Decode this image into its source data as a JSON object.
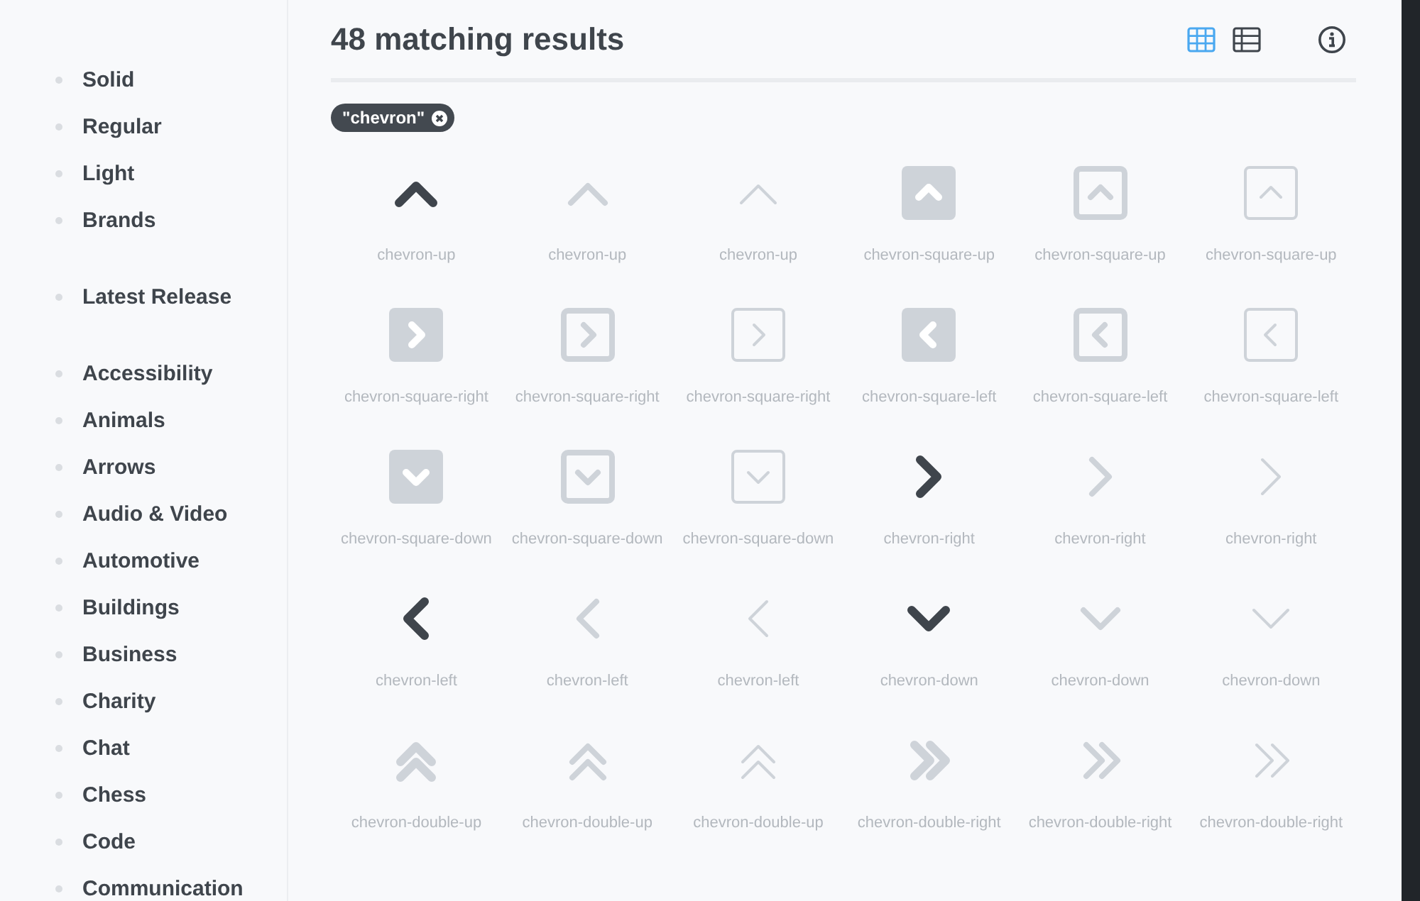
{
  "sidebar": {
    "groups": [
      {
        "items": [
          "Solid",
          "Regular",
          "Light",
          "Brands"
        ]
      },
      {
        "items": [
          "Latest Release"
        ]
      },
      {
        "items": [
          "Accessibility",
          "Animals",
          "Arrows",
          "Audio & Video",
          "Automotive",
          "Buildings",
          "Business",
          "Charity",
          "Chat",
          "Chess",
          "Code",
          "Communication"
        ]
      }
    ]
  },
  "header": {
    "title": "48 matching results",
    "views": [
      {
        "kind": "grid",
        "selected": true
      },
      {
        "kind": "list",
        "selected": false
      }
    ]
  },
  "filter_tag": {
    "label": "\"chevron\""
  },
  "icons": [
    {
      "kind": "upSolid",
      "available": true,
      "label": "chevron-up"
    },
    {
      "kind": "upRegular",
      "available": false,
      "label": "chevron-up"
    },
    {
      "kind": "upLight",
      "available": false,
      "label": "chevron-up"
    },
    {
      "kind": "squareUpSolid",
      "available": false,
      "label": "chevron-square-up"
    },
    {
      "kind": "squareUpRegular",
      "available": false,
      "label": "chevron-square-up"
    },
    {
      "kind": "squareUpLight",
      "available": false,
      "label": "chevron-square-up"
    },
    {
      "kind": "squareRightSolid",
      "available": false,
      "label": "chevron-square-right"
    },
    {
      "kind": "squareRightRegular",
      "available": false,
      "label": "chevron-square-right"
    },
    {
      "kind": "squareRightLight",
      "available": false,
      "label": "chevron-square-right"
    },
    {
      "kind": "squareLeftSolid",
      "available": false,
      "label": "chevron-square-left"
    },
    {
      "kind": "squareLeftRegular",
      "available": false,
      "label": "chevron-square-left"
    },
    {
      "kind": "squareLeftLight",
      "available": false,
      "label": "chevron-square-left"
    },
    {
      "kind": "squareDownSolid",
      "available": false,
      "label": "chevron-square-down"
    },
    {
      "kind": "squareDownRegular",
      "available": false,
      "label": "chevron-square-down"
    },
    {
      "kind": "squareDownLight",
      "available": false,
      "label": "chevron-square-down"
    },
    {
      "kind": "rightSolid",
      "available": true,
      "label": "chevron-right"
    },
    {
      "kind": "rightRegular",
      "available": false,
      "label": "chevron-right"
    },
    {
      "kind": "rightLight",
      "available": false,
      "label": "chevron-right"
    },
    {
      "kind": "leftSolid",
      "available": true,
      "label": "chevron-left"
    },
    {
      "kind": "leftRegular",
      "available": false,
      "label": "chevron-left"
    },
    {
      "kind": "leftLight",
      "available": false,
      "label": "chevron-left"
    },
    {
      "kind": "downSolid",
      "available": true,
      "label": "chevron-down"
    },
    {
      "kind": "downRegular",
      "available": false,
      "label": "chevron-down"
    },
    {
      "kind": "downLight",
      "available": false,
      "label": "chevron-down"
    },
    {
      "kind": "doubleUpSolid",
      "available": false,
      "label": "chevron-double-up"
    },
    {
      "kind": "doubleUpRegular",
      "available": false,
      "label": "chevron-double-up"
    },
    {
      "kind": "doubleUpLight",
      "available": false,
      "label": "chevron-double-up"
    },
    {
      "kind": "doubleRightSolid",
      "available": false,
      "label": "chevron-double-right"
    },
    {
      "kind": "doubleRightRegular",
      "available": false,
      "label": "chevron-double-right"
    },
    {
      "kind": "doubleRightLight",
      "available": false,
      "label": "chevron-double-right"
    }
  ]
}
